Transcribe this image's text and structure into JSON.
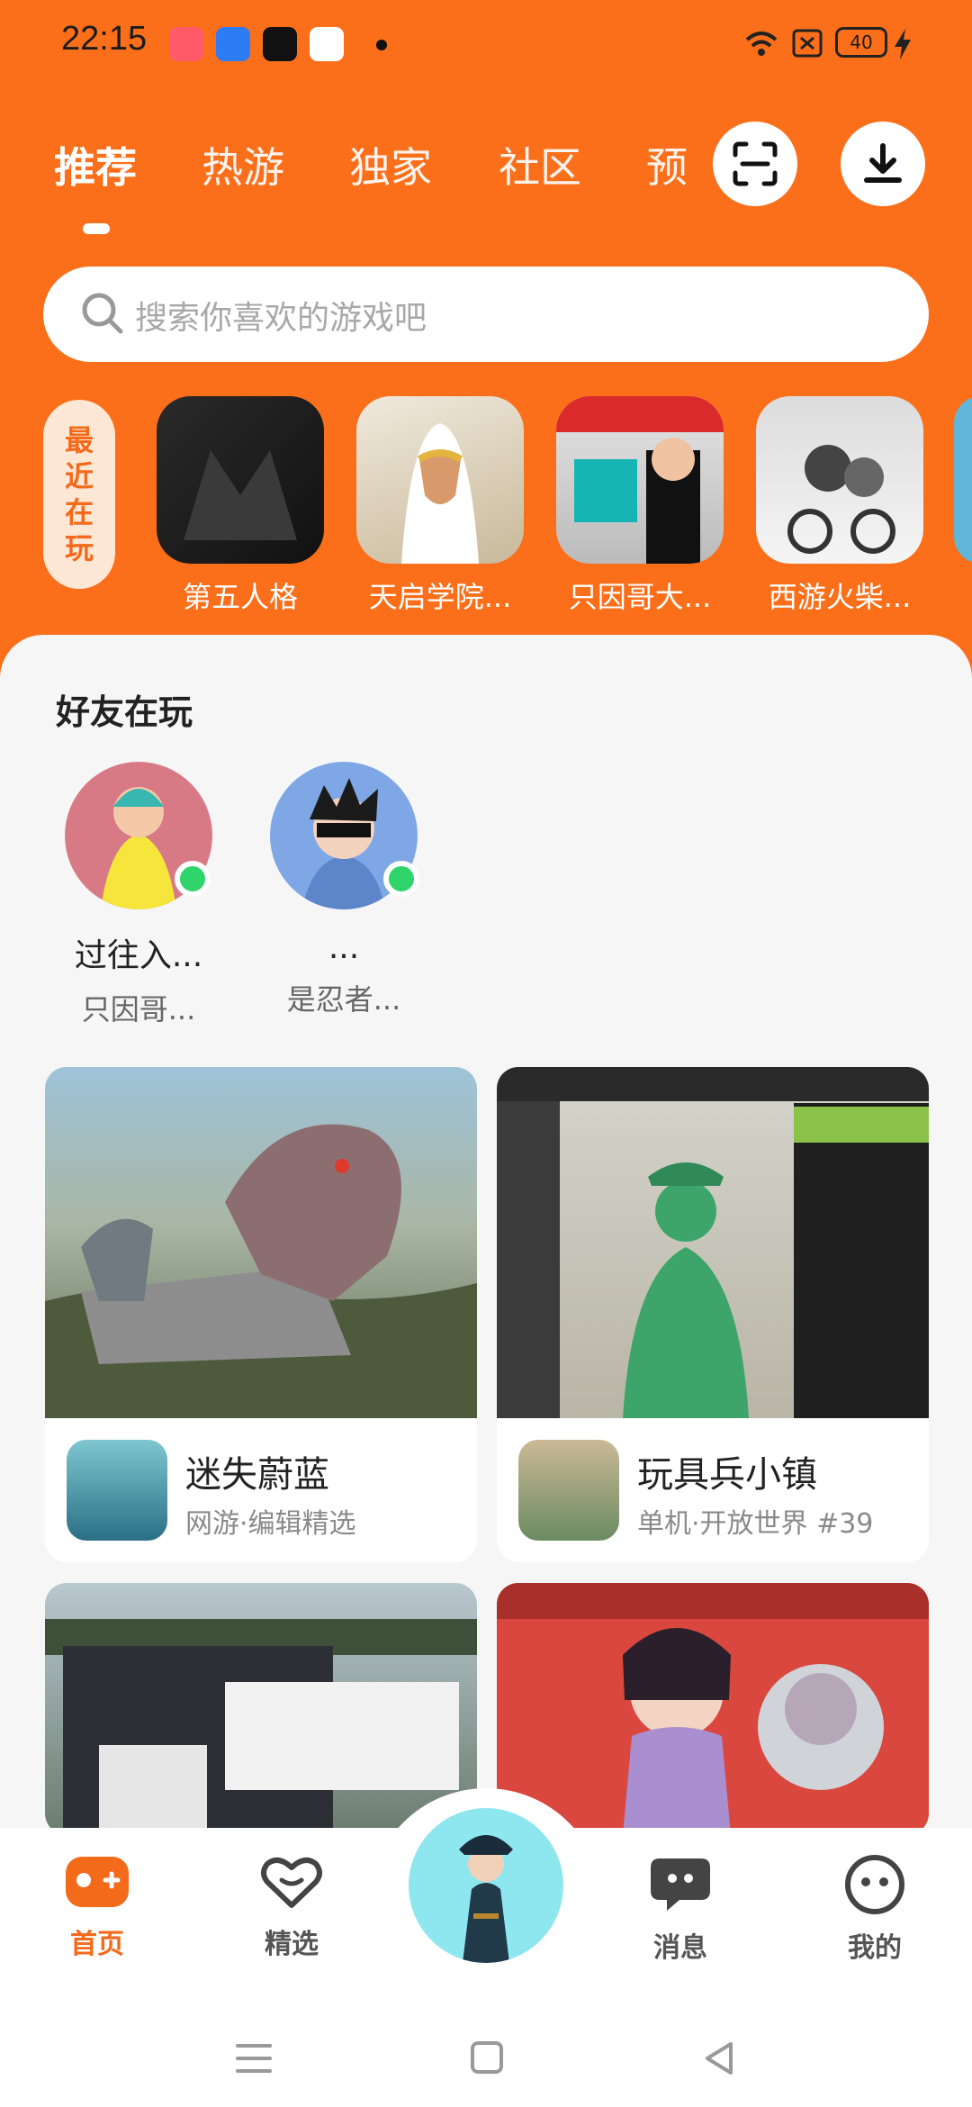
{
  "status_bar": {
    "time": "22:15",
    "battery": "40"
  },
  "tabs": [
    "推荐",
    "热游",
    "独家",
    "社区",
    "预"
  ],
  "search": {
    "placeholder": "搜索你喜欢的游戏吧"
  },
  "recent": {
    "label_chars": [
      "最",
      "近",
      "在",
      "玩"
    ],
    "games": [
      {
        "name": "第五人格"
      },
      {
        "name": "天启学院..."
      },
      {
        "name": "只因哥大..."
      },
      {
        "name": "西游火柴..."
      }
    ]
  },
  "friends": {
    "title": "好友在玩",
    "items": [
      {
        "name": "过往入...",
        "game": "只因哥..."
      },
      {
        "name": "...",
        "game": "是忍者..."
      }
    ]
  },
  "cards": [
    {
      "title": "迷失蔚蓝",
      "subtitle": "网游·编辑精选"
    },
    {
      "title": "玩具兵小镇",
      "subtitle": "单机·开放世界 #39"
    }
  ],
  "bottom_nav": [
    "首页",
    "精选",
    "消息",
    "我的"
  ],
  "colors": {
    "brand": "#fb6f1a",
    "online": "#2fd46b"
  }
}
